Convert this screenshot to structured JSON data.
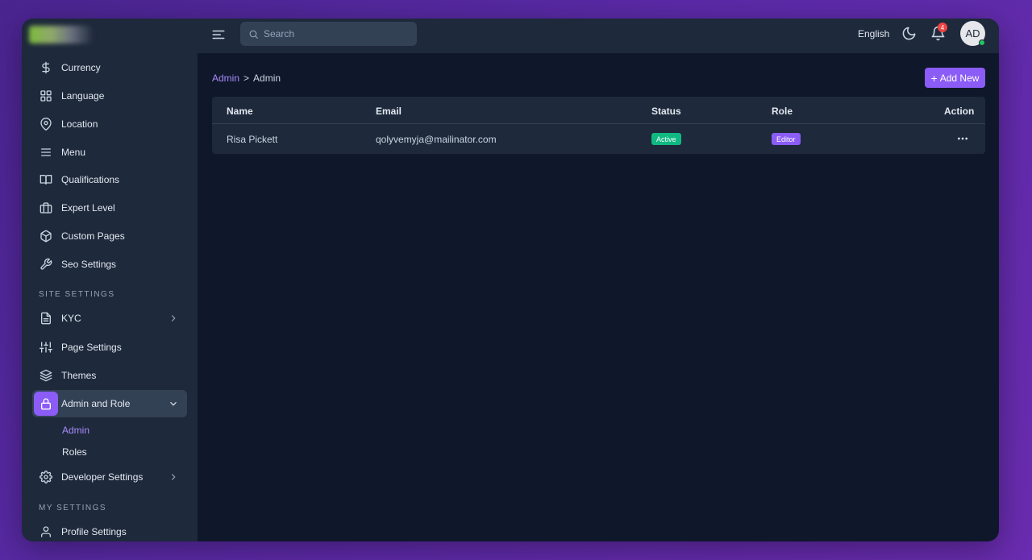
{
  "sidebar": {
    "items_top": [
      {
        "label": "Currency",
        "icon": "dollar-icon"
      },
      {
        "label": "Language",
        "icon": "grid-icon"
      },
      {
        "label": "Location",
        "icon": "map-pin-icon"
      },
      {
        "label": "Menu",
        "icon": "menu-icon"
      },
      {
        "label": "Qualifications",
        "icon": "book-icon"
      },
      {
        "label": "Expert Level",
        "icon": "briefcase-icon"
      },
      {
        "label": "Custom Pages",
        "icon": "box-icon"
      },
      {
        "label": "Seo Settings",
        "icon": "wrench-icon"
      }
    ],
    "site_settings_label": "SITE SETTINGS",
    "items_site": [
      {
        "label": "KYC",
        "icon": "file-icon"
      },
      {
        "label": "Page Settings",
        "icon": "sliders-icon"
      },
      {
        "label": "Themes",
        "icon": "layers-icon"
      },
      {
        "label": "Admin and Role",
        "icon": "lock-icon"
      }
    ],
    "sub_items": [
      {
        "label": "Admin"
      },
      {
        "label": "Roles"
      }
    ],
    "developer_settings": {
      "label": "Developer Settings",
      "icon": "gear-icon"
    },
    "my_settings_label": "MY SETTINGS",
    "profile_settings": {
      "label": "Profile Settings",
      "icon": "user-icon"
    }
  },
  "topbar": {
    "search_placeholder": "Search",
    "language": "English",
    "notification_count": "4",
    "avatar_initials": "AD"
  },
  "breadcrumb": {
    "parent": "Admin",
    "separator": ">",
    "current": "Admin"
  },
  "add_button_label": "Add New",
  "table": {
    "columns": [
      "Name",
      "Email",
      "Status",
      "Role",
      "Action"
    ],
    "rows": [
      {
        "name": "Risa Pickett",
        "email": "qolyvemyja@mailinator.com",
        "status": "Active",
        "role": "Editor"
      }
    ]
  },
  "colors": {
    "accent": "#8b5cf6",
    "status_active": "#10b981",
    "sidebar_bg": "#1e293b",
    "content_bg": "#0f172a"
  }
}
